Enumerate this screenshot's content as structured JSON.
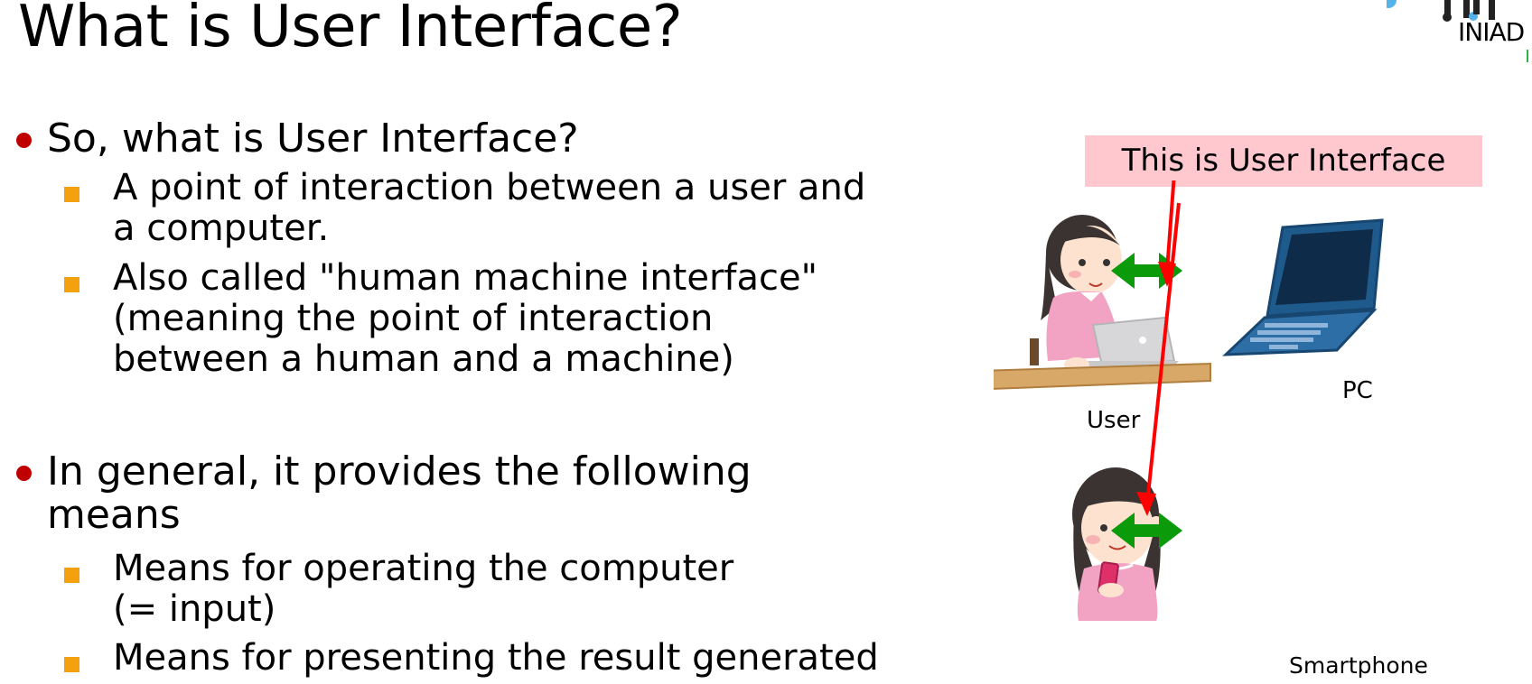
{
  "slide": {
    "title": "What is User Interface?",
    "logo_text": "INIAD"
  },
  "bullets": [
    {
      "text": "So, what is User Interface?",
      "sub": [
        {
          "lines": [
            "A point of interaction between a user and",
            "a computer."
          ]
        },
        {
          "lines": [
            "Also called \"human machine interface\"",
            "(meaning the point of interaction",
            "between a human and a machine)"
          ]
        }
      ]
    },
    {
      "lines": [
        "In general, it provides the following",
        "means"
      ],
      "sub": [
        {
          "lines": [
            "Means for operating the computer",
            "(= input)"
          ]
        },
        {
          "lines": [
            "Means for presenting the result generated"
          ]
        }
      ]
    }
  ],
  "diagram": {
    "caption": "This is User Interface",
    "labels": {
      "user": "User",
      "pc": "PC",
      "smartphone": "Smartphone"
    },
    "colors": {
      "caption_bg": "#ffc7ce",
      "pointer_arrow": "#ff0000",
      "link_arrow": "#00a000",
      "bullet": "#c00000",
      "sub_bullet": "#f5a00f"
    }
  }
}
